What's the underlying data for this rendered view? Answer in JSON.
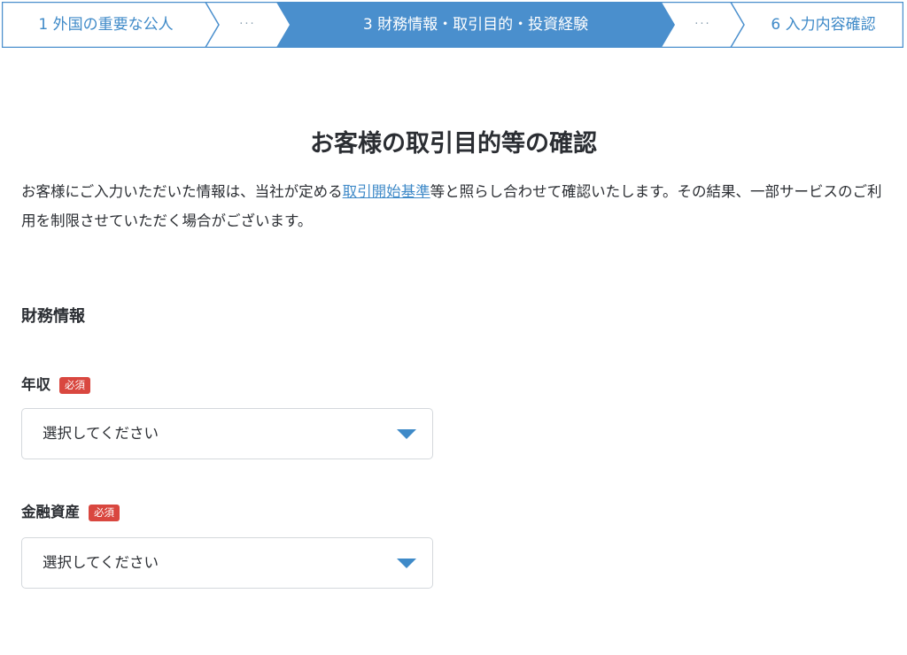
{
  "stepper": {
    "steps": [
      {
        "label": "1 外国の重要な公人",
        "state": "default"
      },
      {
        "label": "···",
        "state": "collapsed"
      },
      {
        "label": "3 財務情報・取引目的・投資経験",
        "state": "active"
      },
      {
        "label": "···",
        "state": "collapsed"
      },
      {
        "label": "6 入力内容確認",
        "state": "default"
      }
    ],
    "colors": {
      "active_bg": "#4a8fcd",
      "border": "#4a8fcd",
      "text": "#3f8ac8"
    }
  },
  "page": {
    "title": "お客様の取引目的等の確認",
    "intro_before": "お客様にご入力いただいた情報は、当社が定める",
    "intro_link": "取引開始基準",
    "intro_after": "等と照らし合わせて確認いたします。その結果、一部サービスのご利用を制限させていただく場合がございます。"
  },
  "financial_section": {
    "title": "財務情報",
    "fields": [
      {
        "label": "年収",
        "required_badge": "必須",
        "select_value": "選択してください"
      },
      {
        "label": "金融資産",
        "required_badge": "必須",
        "select_value": "選択してください"
      }
    ]
  },
  "colors": {
    "required_badge": "#d9473f",
    "link": "#3f8ac8",
    "dropdown_arrow": "#3f8ac8"
  }
}
